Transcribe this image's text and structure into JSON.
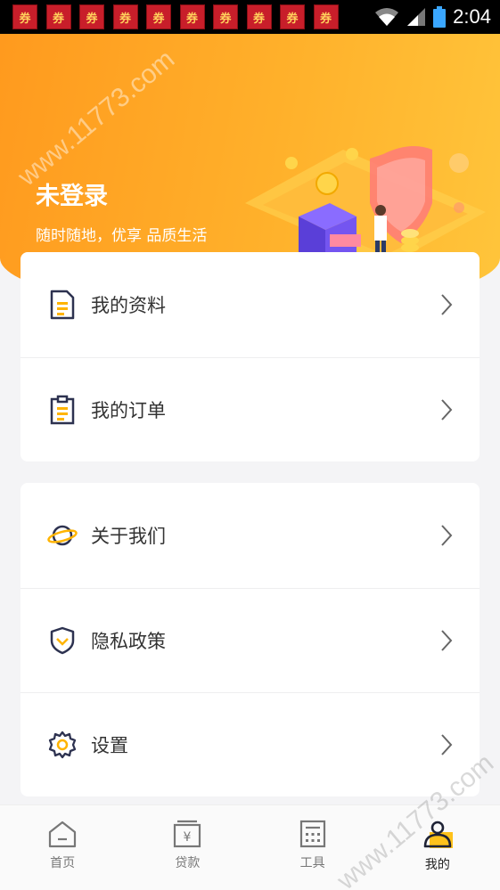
{
  "status_bar": {
    "coupon_label": "券",
    "coupon_count": 10,
    "time": "2:04"
  },
  "header": {
    "user_name": "未登录",
    "slogan": "随时随地，优享 品质生活"
  },
  "menu_group_1": [
    {
      "label": "我的资料",
      "icon": "document-icon"
    },
    {
      "label": "我的订单",
      "icon": "clipboard-icon"
    }
  ],
  "menu_group_2": [
    {
      "label": "关于我们",
      "icon": "planet-icon"
    },
    {
      "label": "隐私政策",
      "icon": "shield-icon"
    },
    {
      "label": "设置",
      "icon": "gear-icon"
    }
  ],
  "tabbar": [
    {
      "label": "首页",
      "icon": "home-icon",
      "active": false
    },
    {
      "label": "贷款",
      "icon": "loan-icon",
      "active": false
    },
    {
      "label": "工具",
      "icon": "calculator-icon",
      "active": false
    },
    {
      "label": "我的",
      "icon": "user-icon",
      "active": true
    }
  ],
  "watermark": "www.11773.com",
  "colors": {
    "header_start": "#ff9a1e",
    "header_end": "#ffc53b",
    "accent": "#ffb400"
  }
}
